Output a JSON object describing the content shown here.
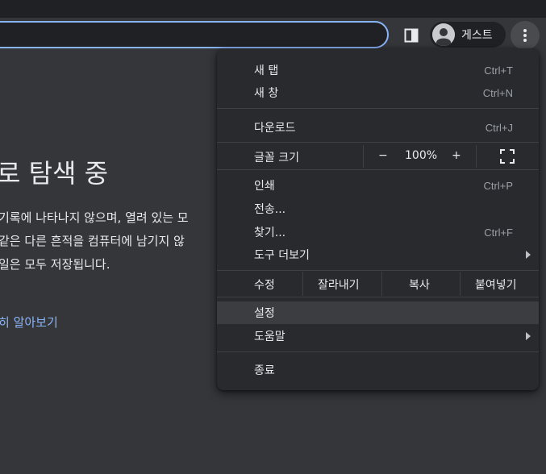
{
  "toolbar": {
    "profile_label": "게스트",
    "accent": "#8ab4f8"
  },
  "page": {
    "title": "로 탐색 중",
    "para_lines": [
      "기록에 나타나지 않으며, 열려 있는 모",
      "같은 다른 흔적을 컴퓨터에 남기지 않",
      "일은 모두 저장됩니다."
    ],
    "learn_more": "히 알아보기"
  },
  "menu": {
    "new_tab": {
      "label": "새 탭",
      "shortcut": "Ctrl+T"
    },
    "new_window": {
      "label": "새 창",
      "shortcut": "Ctrl+N"
    },
    "downloads": {
      "label": "다운로드",
      "shortcut": "Ctrl+J"
    },
    "zoom": {
      "label": "글꼴 크기",
      "minus": "−",
      "value": "100%",
      "plus": "+"
    },
    "print": {
      "label": "인쇄",
      "shortcut": "Ctrl+P"
    },
    "cast": {
      "label": "전송..."
    },
    "find": {
      "label": "찾기...",
      "shortcut": "Ctrl+F"
    },
    "more_tools": {
      "label": "도구 더보기"
    },
    "edit": {
      "label": "수정",
      "cut": "잘라내기",
      "copy": "복사",
      "paste": "붙여넣기"
    },
    "settings": {
      "label": "설정"
    },
    "help": {
      "label": "도움말"
    },
    "exit": {
      "label": "종료"
    }
  },
  "icons": {
    "sidepanel": "side-panel-icon",
    "profile": "person-icon",
    "menu": "three-dots-vertical-icon",
    "fullscreen": "fullscreen-icon",
    "submenu": "chevron-right-icon"
  }
}
